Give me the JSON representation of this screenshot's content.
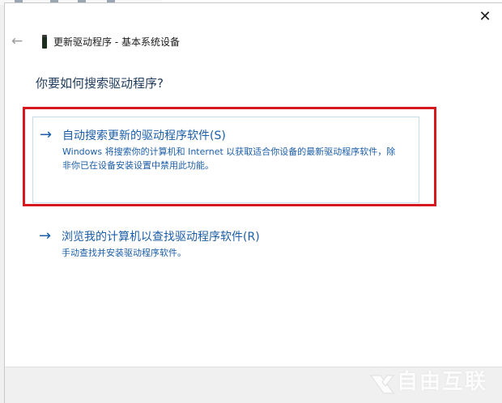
{
  "dialog": {
    "title": "更新驱动程序 - 基本系统设备",
    "close_glyph": "✕",
    "back_glyph": "←",
    "question": "你要如何搜索驱动程序?"
  },
  "options": [
    {
      "arrow": "→",
      "title": "自动搜索更新的驱动程序软件(S)",
      "description": "Windows 将搜索你的计算机和 Internet 以获取适合你设备的最新驱动程序软件，除非你已在设备安装设置中禁用此功能。",
      "selected": true
    },
    {
      "arrow": "→",
      "title": "浏览我的计算机以查找驱动程序软件(R)",
      "description": "手动查找并安装驱动程序软件。",
      "selected": false
    }
  ],
  "watermark": {
    "text": "自由互联"
  },
  "colors": {
    "link": "#1c5ea8",
    "highlight_frame": "#d7171f",
    "option_border": "#c8dbe8"
  },
  "icons": {
    "back": "back-arrow-icon",
    "device": "device-icon",
    "close": "close-icon",
    "option_arrow": "right-arrow-icon"
  }
}
